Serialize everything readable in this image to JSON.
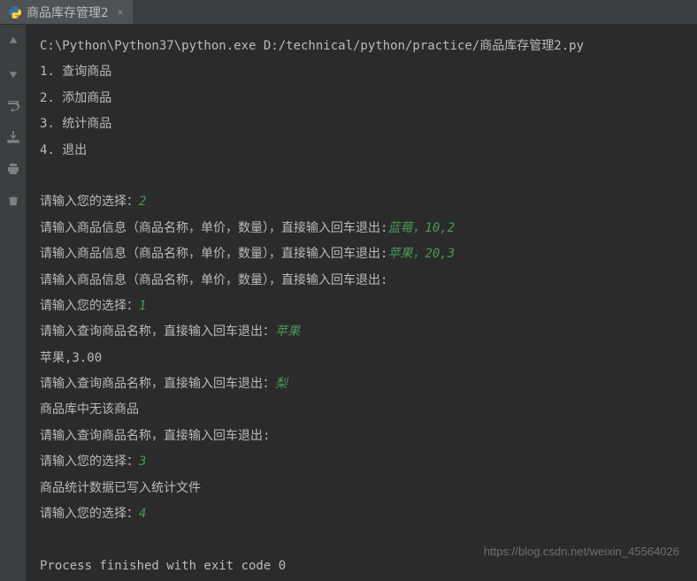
{
  "tab": {
    "title": "商品库存管理2",
    "icon": "python-icon"
  },
  "console": {
    "command": "C:\\Python\\Python37\\python.exe D:/technical/python/practice/商品库存管理2.py",
    "menu": {
      "item1": "1. 查询商品",
      "item2": "2. 添加商品",
      "item3": "3. 统计商品",
      "item4": "4. 退出"
    },
    "lines": {
      "prompt_choice1": "请输入您的选择：",
      "input1": "2",
      "prompt_product1": "请输入商品信息（商品名称，单价，数量），直接输入回车退出:",
      "input_product1": "蓝莓，10,2",
      "prompt_product2": "请输入商品信息（商品名称，单价，数量），直接输入回车退出:",
      "input_product2": "苹果，20,3",
      "prompt_product3": "请输入商品信息（商品名称，单价，数量），直接输入回车退出:",
      "prompt_choice2": "请输入您的选择：",
      "input2": "1",
      "prompt_query1": "请输入查询商品名称，直接输入回车退出：",
      "input_query1": "苹果",
      "result1": "苹果,3.00",
      "prompt_query2": "请输入查询商品名称，直接输入回车退出：",
      "input_query2": "梨",
      "result2": "商品库中无该商品",
      "prompt_query3": "请输入查询商品名称，直接输入回车退出:",
      "prompt_choice3": "请输入您的选择：",
      "input3": "3",
      "result3": "商品统计数据已写入统计文件",
      "prompt_choice4": "请输入您的选择：",
      "input4": "4",
      "exit": "Process finished with exit code 0"
    }
  },
  "watermark": "https://blog.csdn.net/weixin_45564026"
}
